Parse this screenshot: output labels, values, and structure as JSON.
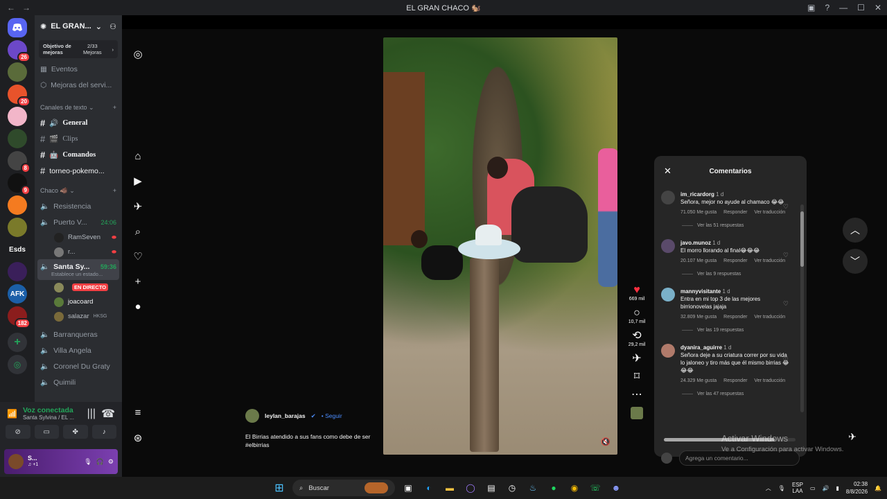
{
  "window": {
    "title": "EL GRAN CHACO 🐿️",
    "back": "←",
    "forward": "→"
  },
  "servers": [
    {
      "label": "",
      "color": "#5865f2",
      "badge": ""
    },
    {
      "label": "",
      "color": "#6c48c8",
      "badge": "26"
    },
    {
      "label": "",
      "color": "#5a6b3a",
      "badge": ""
    },
    {
      "label": "",
      "color": "#e8532b",
      "badge": "20"
    },
    {
      "label": "",
      "color": "#f2b6c9",
      "badge": ""
    },
    {
      "label": "",
      "color": "#2f4a2b",
      "badge": ""
    },
    {
      "label": "",
      "color": "#444",
      "badge": "8"
    },
    {
      "label": "",
      "color": "#111",
      "badge": "9"
    },
    {
      "label": "",
      "color": "#f47b20",
      "badge": ""
    },
    {
      "label": "",
      "color": "#7a7a2a",
      "badge": ""
    },
    {
      "label": "Esds",
      "color": "#1e1f22",
      "badge": ""
    },
    {
      "label": "",
      "color": "#3a1f5a",
      "badge": ""
    },
    {
      "label": "AFK",
      "color": "#1b5fa8",
      "badge": ""
    },
    {
      "label": "",
      "color": "#8b1d1d",
      "badge": "182"
    }
  ],
  "guild": {
    "name": "EL GRAN...",
    "boost_label": "Objetivo de mejoras",
    "boost_count": "2/33",
    "boost_unit": "Mejoras"
  },
  "channels": {
    "events": "Eventos",
    "boosts": "Mejoras del servi...",
    "text_category": "Canales de texto",
    "text": [
      {
        "name": "General",
        "emoji": "🔊"
      },
      {
        "name": "Clips",
        "emoji": "🎬"
      },
      {
        "name": "Comandos",
        "emoji": "🤖"
      },
      {
        "name": "torneo-pokemo...",
        "emoji": ""
      }
    ],
    "voice_category": "Chaco 🐗",
    "voice": [
      {
        "name": "Resistencia",
        "time": ""
      },
      {
        "name": "Puerto V...",
        "time": "24:06"
      }
    ],
    "puerto_users": [
      {
        "name": "RamSeven"
      },
      {
        "name": "r..."
      }
    ],
    "active": {
      "name": "Santa Sy...",
      "time": "59:36",
      "status": "Establece un estado..."
    },
    "active_users": [
      {
        "name": "᠎",
        "live": "EN DIRECTO"
      },
      {
        "name": "joacoard",
        "live": ""
      },
      {
        "name": "salazar",
        "live": ""
      }
    ],
    "hksg": "HKSG",
    "more_voice": [
      "Barranqueras",
      "Villa Angela",
      "Coronel Du Graty",
      "Quimili"
    ]
  },
  "voice_panel": {
    "status": "Voz conectada",
    "location": "Santa Sylvina / EL ..."
  },
  "user": {
    "name": "S...",
    "sub": "♫ +1"
  },
  "post": {
    "username": "leylan_barajas",
    "follow": "Seguir",
    "caption": "El Birrias atendido a sus fans como debe de ser #elbirrias",
    "likes": "669 mil",
    "comments_count": "10,7 mil",
    "reposts": "29,2 mil"
  },
  "comments": {
    "title": "Comentarios",
    "like_label": "Me gusta",
    "reply_label": "Responder",
    "translate_label": "Ver traducción",
    "items": [
      {
        "user": "im_ricardorg",
        "age": "1 d",
        "text": "Señora, mejor no ayude al chamaco 😂😂",
        "likes": "71.050",
        "more": "Ver las 51 respuestas",
        "avatar": "#444"
      },
      {
        "user": "javo.munoz",
        "age": "1 d",
        "text": "El morro llorando al final😂😂😂",
        "likes": "20.107",
        "more": "Ver las 9 respuestas",
        "avatar": "#5a4a6a"
      },
      {
        "user": "mannyvisitante",
        "age": "1 d",
        "text": "Entra en mi top 3 de las mejores birrionovelas jajaja",
        "likes": "32.809",
        "more": "Ver las 19 respuestas",
        "avatar": "#7ab0c8"
      },
      {
        "user": "dyanira_aguirre",
        "age": "1 d",
        "text": "Señora deje a su criatura correr por su vida lo jaloneo y tiro más que él mismo birrias 😂😂😂",
        "likes": "24.329",
        "more": "Ver las 47 respuestas",
        "avatar": "#b07a6a"
      }
    ],
    "input_placeholder": "Agrega un comentario..."
  },
  "watermark": {
    "title": "Activar Windows",
    "sub": "Ve a Configuración para activar Windows."
  },
  "taskbar": {
    "search": "Buscar",
    "lang": "ESP",
    "layout": "LAA",
    "time": "02:38",
    "date": "8/8/2026"
  }
}
